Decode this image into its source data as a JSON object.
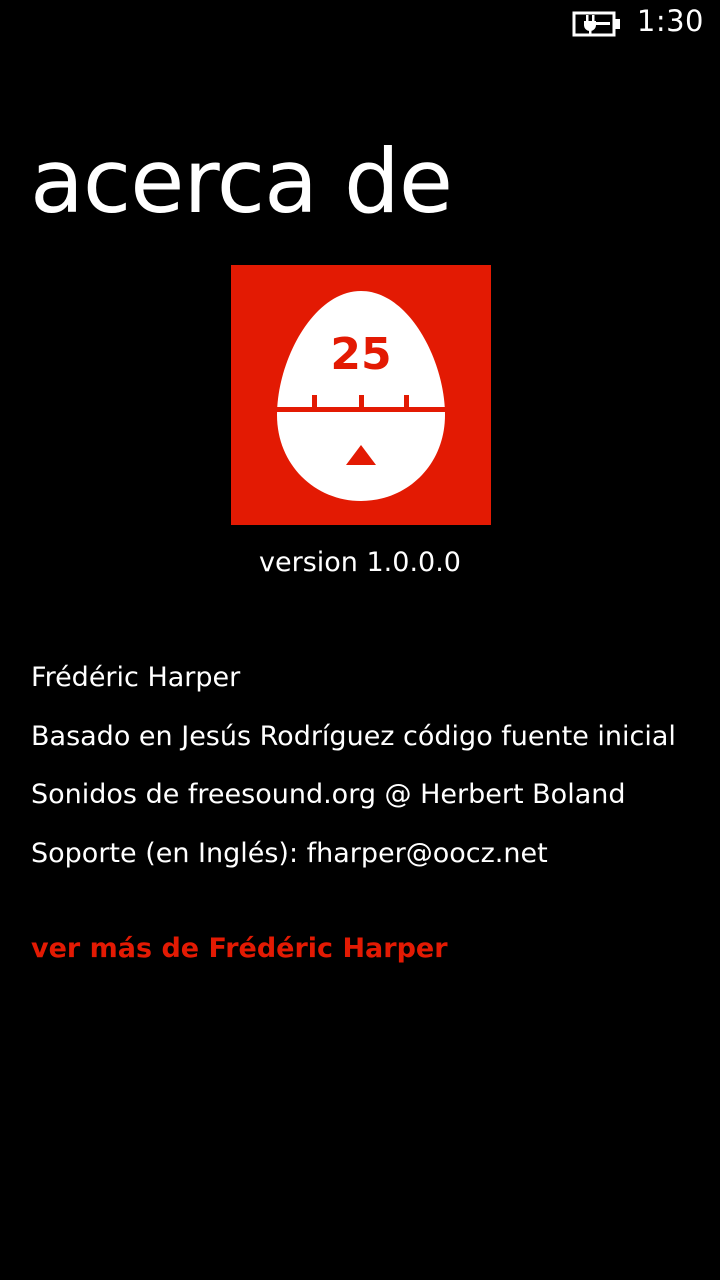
{
  "status_bar": {
    "time": "1:30",
    "battery_icon": "battery-charging-icon"
  },
  "page": {
    "title": "acerca de"
  },
  "logo": {
    "icon": "pomodoro-egg-timer-icon",
    "number": "25",
    "background_color": "#e31a03"
  },
  "version": "version 1.0.0.0",
  "info": {
    "author": "Frédéric Harper",
    "based_on": "Basado en Jesús Rodríguez código fuente inicial",
    "sounds": "Sonidos de freesound.org @ Herbert Boland",
    "support": "Soporte (en Inglés): fharper@oocz.net"
  },
  "more_link": {
    "label": "ver más de Frédéric Harper",
    "color": "#e31a03"
  }
}
